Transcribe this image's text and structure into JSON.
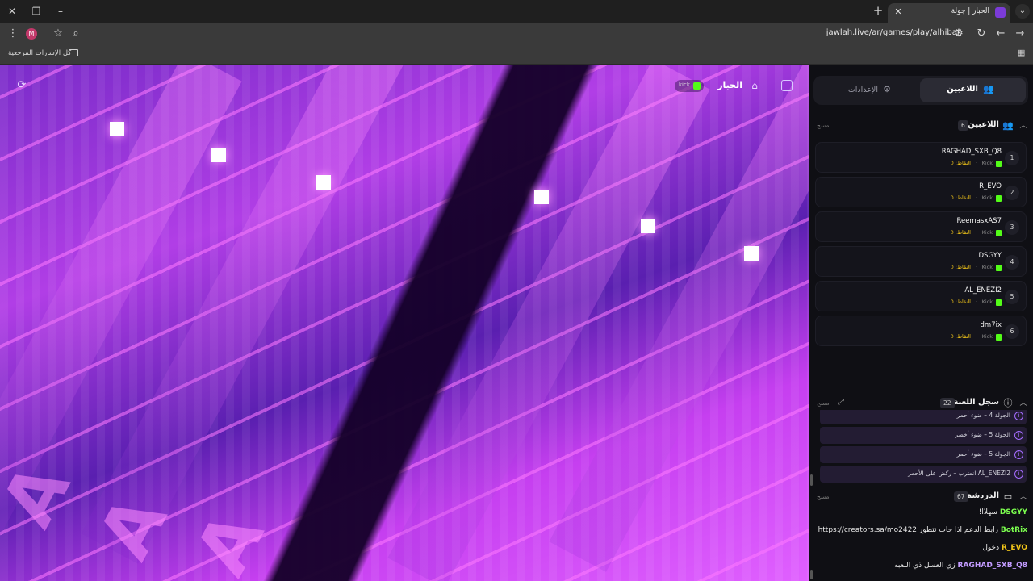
{
  "browser": {
    "tab_title": "الحبار | جولة",
    "url": "jawlah.live/ar/games/play/alhibar",
    "bookmarks_label": "كل الإشارات المرجعية",
    "profile_initial": "M"
  },
  "game": {
    "title": "الحبار",
    "platform_badge": "kick"
  },
  "sidebar": {
    "tabs": {
      "players": "اللاعبين",
      "settings": "الإعدادات"
    },
    "players_section": {
      "title": "اللاعبين",
      "count": "6",
      "clear": "مسح"
    },
    "players": [
      {
        "rank": "1",
        "name": "RAGHAD_SXB_Q8",
        "platform": "Kick",
        "points": "النقاط: 0"
      },
      {
        "rank": "2",
        "name": "R_EVO",
        "platform": "Kick",
        "points": "النقاط: 0"
      },
      {
        "rank": "3",
        "name": "ReemasxAS7",
        "platform": "Kick",
        "points": "النقاط: 0"
      },
      {
        "rank": "4",
        "name": "DSGYY",
        "platform": "Kick",
        "points": "النقاط: 0"
      },
      {
        "rank": "5",
        "name": "AL_ENEZI2",
        "platform": "Kick",
        "points": "النقاط: 0"
      },
      {
        "rank": "6",
        "name": "dm7ix",
        "platform": "Kick",
        "points": "النقاط: 0"
      }
    ],
    "log_section": {
      "title": "سجل اللعبة",
      "count": "22",
      "clear": "مسح"
    },
    "log": [
      "الجولة 4 – ضوء أحمر",
      "الجولة 5 – ضوء أخضر",
      "الجولة 5 – ضوء أحمر",
      "AL_ENEZI2 انضرب – ركض على الأحمر"
    ],
    "chat_section": {
      "title": "الدردشة",
      "count": "67",
      "clear": "مسح"
    },
    "chat": [
      {
        "user": "DSGYY",
        "color": "#7CFF4F",
        "message": "سهلاا!"
      },
      {
        "user": "BotRix",
        "color": "#7CFF4F",
        "message": "رابط الدعم اذا حاب نتطور https://creators.sa/mo2422"
      },
      {
        "user": "R_EVO",
        "color": "#f0c419",
        "message": "دخول"
      },
      {
        "user": "RAGHAD_SXB_Q8",
        "color": "#c29bff",
        "message": "زي العسل ذي اللعبه"
      }
    ]
  }
}
